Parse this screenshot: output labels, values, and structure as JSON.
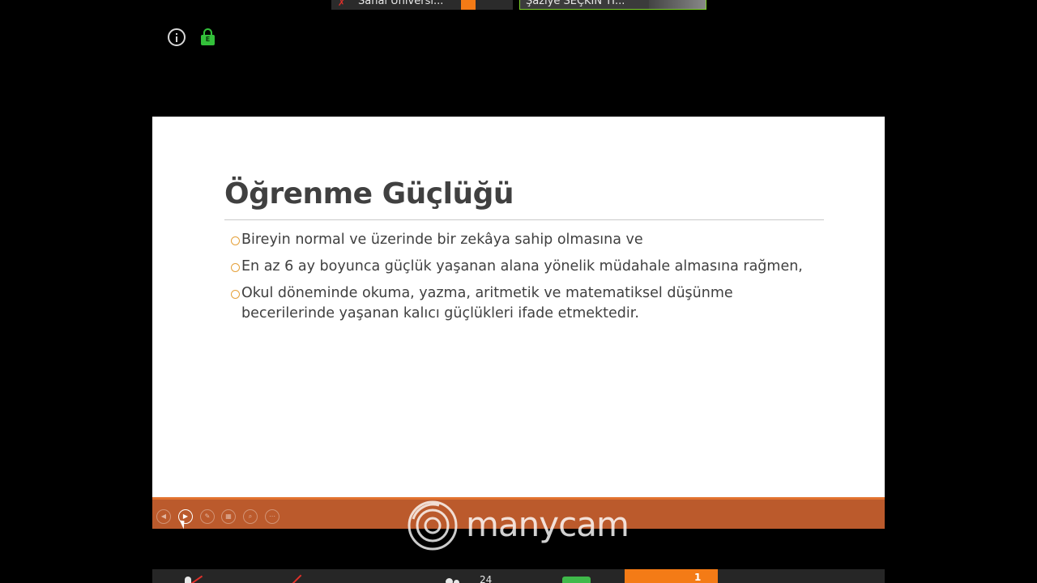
{
  "participants": [
    {
      "name": "Sanal Üniversi...",
      "mic": "muted"
    },
    {
      "name": "Şaziye SEÇKİN Tİ..."
    }
  ],
  "icons": {
    "info": "info-icon",
    "lock": "lock-icon",
    "lock_letter": "E"
  },
  "slide": {
    "title": "Öğrenme Güçlüğü",
    "bullets": [
      "Bireyin normal ve üzerinde bir zekâya sahip olmasına ve",
      "En az 6 ay boyunca güçlük yaşanan alana yönelik müdahale almasına rağmen,",
      "Okul döneminde okuma, yazma, aritmetik ve matematiksel düşünme becerilerinde yaşanan kalıcı güçlükleri ifade etmektedir."
    ]
  },
  "slide_toolbar": {
    "tools": [
      {
        "name": "previous-slide-button",
        "glyph": "◀"
      },
      {
        "name": "next-slide-button",
        "glyph": "▶",
        "active": true
      },
      {
        "name": "pen-tool-button",
        "glyph": "✎"
      },
      {
        "name": "see-all-slides-button",
        "glyph": "▦"
      },
      {
        "name": "zoom-button",
        "glyph": "⌕"
      },
      {
        "name": "more-options-button",
        "glyph": "⋯"
      }
    ]
  },
  "watermark": {
    "text": "manycam"
  },
  "bottom_bar": {
    "participant_count": "24",
    "share_count": "1",
    "colors": {
      "muted": "#e0302a",
      "chat": "#3fb94a",
      "share": "#f47b16"
    }
  },
  "colors": {
    "slide_bar": "#bb5a2c",
    "slide_bar_accent": "#e2722f",
    "bullet_marker": "#e5a13a",
    "lock": "#33c03a"
  }
}
